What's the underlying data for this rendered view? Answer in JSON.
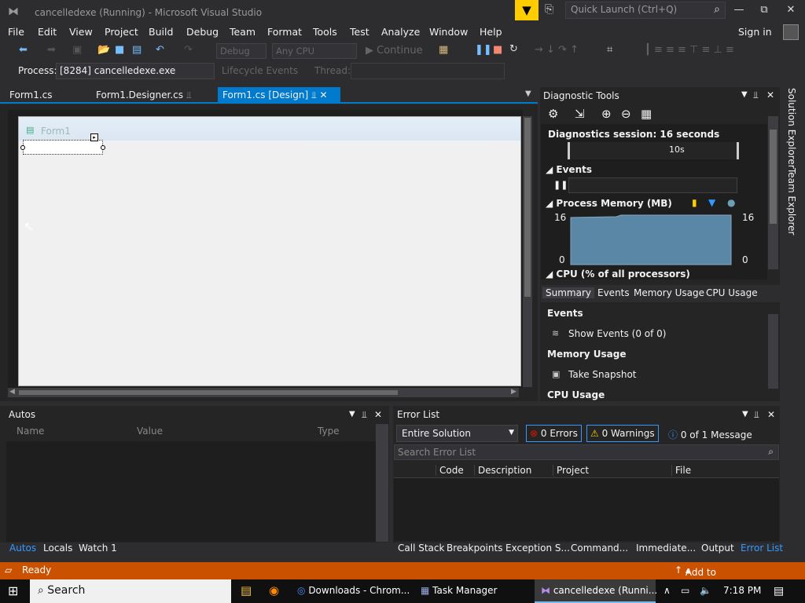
{
  "titlebar": {
    "title": "cancelledexe (Running) - Microsoft Visual Studio",
    "quick_launch_placeholder": "Quick Launch (Ctrl+Q)"
  },
  "menu": [
    "File",
    "Edit",
    "View",
    "Project",
    "Build",
    "Debug",
    "Team",
    "Format",
    "Tools",
    "Test",
    "Analyze",
    "Window",
    "Help"
  ],
  "sign_in": "Sign in",
  "toolbar": {
    "config": "Debug",
    "platform": "Any CPU",
    "continue": "Continue"
  },
  "process": {
    "label": "Process:",
    "value": "[8284] cancelledexe.exe",
    "lifecycle": "Lifecycle Events",
    "thread": "Thread:"
  },
  "doc_tabs": [
    {
      "label": "Form1.cs"
    },
    {
      "label": "Form1.Designer.cs"
    },
    {
      "label": "Form1.cs [Design]"
    }
  ],
  "designer": {
    "form_title": "Form1"
  },
  "diagnostic": {
    "title": "Diagnostic Tools",
    "session": "Diagnostics session: 16 seconds",
    "tick": "10s",
    "events": "Events",
    "memory": "Process Memory (MB)",
    "mem_max": "16",
    "mem_min": "0",
    "cpu": "CPU (% of all processors)",
    "tabs": [
      "Summary",
      "Events",
      "Memory Usage",
      "CPU Usage"
    ],
    "summary": {
      "events_h": "Events",
      "show_events": "Show Events (0 of 0)",
      "memory_h": "Memory Usage",
      "snapshot": "Take Snapshot",
      "cpu_h": "CPU Usage"
    }
  },
  "side_tabs": [
    "Solution Explorer",
    "Team Explorer"
  ],
  "autos": {
    "title": "Autos",
    "cols": [
      "Name",
      "Value",
      "Type"
    ],
    "tabs": [
      "Autos",
      "Locals",
      "Watch 1"
    ]
  },
  "errors": {
    "title": "Error List",
    "scope": "Entire Solution",
    "errors": "0 Errors",
    "warnings": "0 Warnings",
    "messages": "0 of 1 Message",
    "search": "Search Error List",
    "cols": [
      "Code",
      "Description",
      "Project",
      "File"
    ],
    "tabs": [
      "Call Stack",
      "Breakpoints",
      "Exception S...",
      "Command...",
      "Immediate...",
      "Output",
      "Error List"
    ]
  },
  "status": {
    "ready": "Ready",
    "source_control": "Add to Source Control"
  },
  "taskbar": {
    "search": "Search",
    "items": [
      "Downloads - Chrom...",
      "Task Manager",
      "cancelledexe (Runni..."
    ],
    "time": "7:18 PM"
  }
}
